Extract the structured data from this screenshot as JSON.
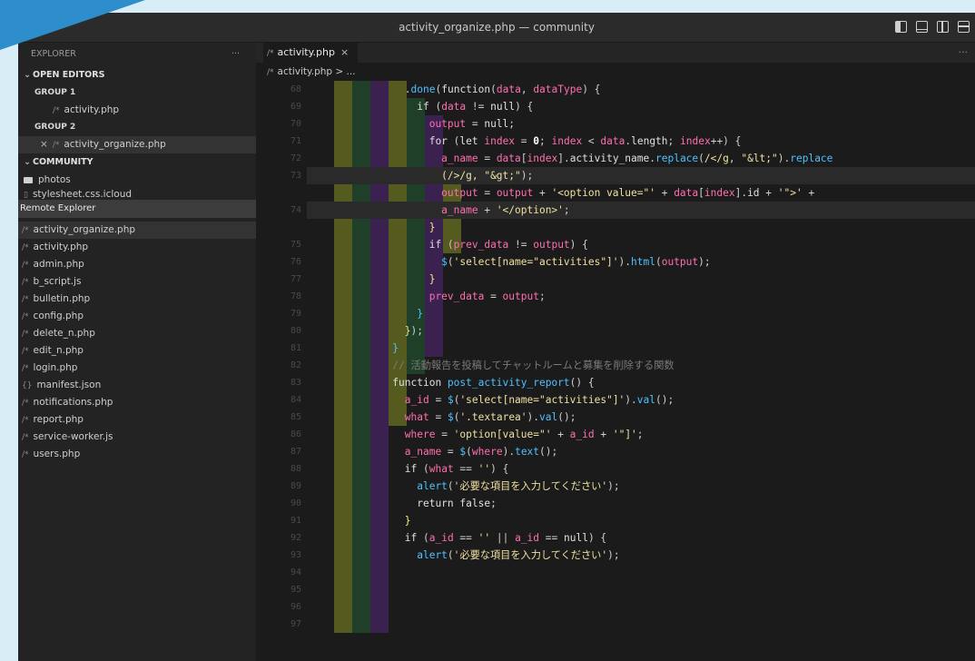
{
  "window": {
    "title": "activity_organize.php — community"
  },
  "sidebar": {
    "explorer_label": "EXPLORER",
    "more": "···",
    "open_editors": "OPEN EDITORS",
    "group1": "GROUP 1",
    "group1_file": "activity.php",
    "group2": "GROUP 2",
    "group2_file": "activity_organize.php",
    "close_glyph": "×",
    "community": "COMMUNITY",
    "folder1": "photos",
    "folder2": "stylesheet.css.icloud",
    "remote_explorer": "Remote Explorer",
    "files": [
      "activity_organize.php",
      "activity.php",
      "admin.php",
      "b_script.js",
      "bulletin.php",
      "config.php",
      "delete_n.php",
      "edit_n.php",
      "login.php",
      "manifest.json",
      "notifications.php",
      "report.php",
      "service-worker.js",
      "users.php"
    ],
    "file_icons": [
      "/*",
      "/*",
      "/*",
      "/*",
      "/*",
      "/*",
      "/*",
      "/*",
      "/*",
      "{}",
      "/*",
      "/*",
      "/*",
      "/*"
    ]
  },
  "editor": {
    "tab_label": "activity.php",
    "tab_close": "×",
    "tab_more": "···",
    "breadcrumb": "activity.php > ...",
    "php_icon": "/*"
  },
  "colors": {
    "accent": "#2e8ecc",
    "background": "#d9edf7",
    "sidebar": "#232323",
    "editor": "#1b1b1b",
    "rainbow": [
      "#555a1f",
      "#1f3f28",
      "#3a2150"
    ]
  }
}
